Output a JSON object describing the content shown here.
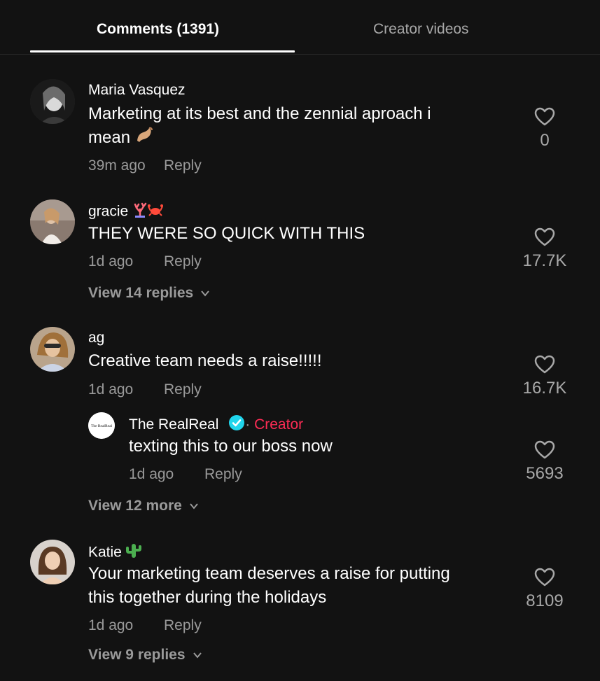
{
  "tabs": {
    "comments_label": "Comments (1391)",
    "creator_label": "Creator videos"
  },
  "comments": [
    {
      "name": "Maria Vasquez",
      "text_line1": "Marketing at its best and the zennial aproach i",
      "text_line2": "mean",
      "time": "39m ago",
      "reply": "Reply",
      "likes": "0"
    },
    {
      "name": "gracie",
      "text": "THEY WERE SO QUICK WITH THIS",
      "time": "1d ago",
      "reply": "Reply",
      "likes": "17.7K",
      "view": "View 14 replies"
    },
    {
      "name": "ag",
      "text": "Creative team needs a raise!!!!!",
      "time": "1d ago",
      "reply": "Reply",
      "likes": "16.7K",
      "view": "View 12 more",
      "sub": {
        "name": "The RealReal",
        "dot": "·",
        "badge": "Creator",
        "text": "texting this to our boss now",
        "time": "1d ago",
        "reply": "Reply",
        "likes": "5693",
        "avatar_text": "The RealReal"
      }
    },
    {
      "name": "Katie",
      "text_line1": "Your marketing team deserves a raise for putting",
      "text_line2": "this together during the holidays",
      "time": "1d ago",
      "reply": "Reply",
      "likes": "8109",
      "view": "View 9 replies"
    }
  ],
  "colors": {
    "background": "#121212",
    "creator_badge": "#fe2c55",
    "verified": "#20d5ec",
    "muted": "#9a9a9a"
  }
}
